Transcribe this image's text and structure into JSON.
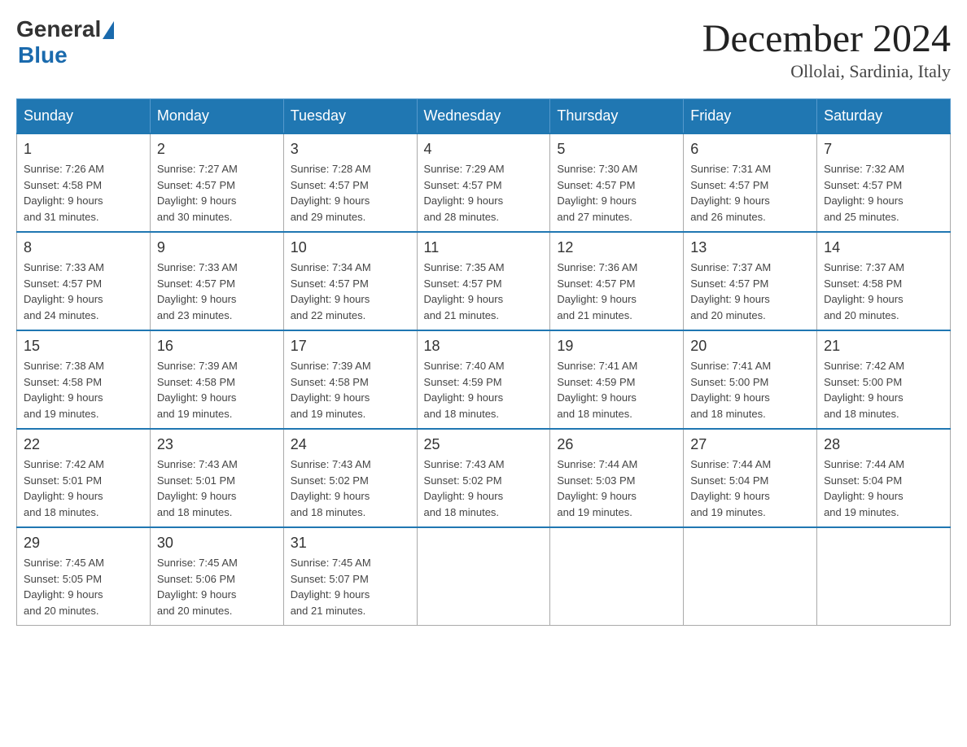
{
  "logo": {
    "general": "General",
    "blue": "Blue"
  },
  "header": {
    "title": "December 2024",
    "location": "Ollolai, Sardinia, Italy"
  },
  "weekdays": [
    "Sunday",
    "Monday",
    "Tuesday",
    "Wednesday",
    "Thursday",
    "Friday",
    "Saturday"
  ],
  "weeks": [
    [
      {
        "day": "1",
        "sunrise": "7:26 AM",
        "sunset": "4:58 PM",
        "daylight": "9 hours and 31 minutes."
      },
      {
        "day": "2",
        "sunrise": "7:27 AM",
        "sunset": "4:57 PM",
        "daylight": "9 hours and 30 minutes."
      },
      {
        "day": "3",
        "sunrise": "7:28 AM",
        "sunset": "4:57 PM",
        "daylight": "9 hours and 29 minutes."
      },
      {
        "day": "4",
        "sunrise": "7:29 AM",
        "sunset": "4:57 PM",
        "daylight": "9 hours and 28 minutes."
      },
      {
        "day": "5",
        "sunrise": "7:30 AM",
        "sunset": "4:57 PM",
        "daylight": "9 hours and 27 minutes."
      },
      {
        "day": "6",
        "sunrise": "7:31 AM",
        "sunset": "4:57 PM",
        "daylight": "9 hours and 26 minutes."
      },
      {
        "day": "7",
        "sunrise": "7:32 AM",
        "sunset": "4:57 PM",
        "daylight": "9 hours and 25 minutes."
      }
    ],
    [
      {
        "day": "8",
        "sunrise": "7:33 AM",
        "sunset": "4:57 PM",
        "daylight": "9 hours and 24 minutes."
      },
      {
        "day": "9",
        "sunrise": "7:33 AM",
        "sunset": "4:57 PM",
        "daylight": "9 hours and 23 minutes."
      },
      {
        "day": "10",
        "sunrise": "7:34 AM",
        "sunset": "4:57 PM",
        "daylight": "9 hours and 22 minutes."
      },
      {
        "day": "11",
        "sunrise": "7:35 AM",
        "sunset": "4:57 PM",
        "daylight": "9 hours and 21 minutes."
      },
      {
        "day": "12",
        "sunrise": "7:36 AM",
        "sunset": "4:57 PM",
        "daylight": "9 hours and 21 minutes."
      },
      {
        "day": "13",
        "sunrise": "7:37 AM",
        "sunset": "4:57 PM",
        "daylight": "9 hours and 20 minutes."
      },
      {
        "day": "14",
        "sunrise": "7:37 AM",
        "sunset": "4:58 PM",
        "daylight": "9 hours and 20 minutes."
      }
    ],
    [
      {
        "day": "15",
        "sunrise": "7:38 AM",
        "sunset": "4:58 PM",
        "daylight": "9 hours and 19 minutes."
      },
      {
        "day": "16",
        "sunrise": "7:39 AM",
        "sunset": "4:58 PM",
        "daylight": "9 hours and 19 minutes."
      },
      {
        "day": "17",
        "sunrise": "7:39 AM",
        "sunset": "4:58 PM",
        "daylight": "9 hours and 19 minutes."
      },
      {
        "day": "18",
        "sunrise": "7:40 AM",
        "sunset": "4:59 PM",
        "daylight": "9 hours and 18 minutes."
      },
      {
        "day": "19",
        "sunrise": "7:41 AM",
        "sunset": "4:59 PM",
        "daylight": "9 hours and 18 minutes."
      },
      {
        "day": "20",
        "sunrise": "7:41 AM",
        "sunset": "5:00 PM",
        "daylight": "9 hours and 18 minutes."
      },
      {
        "day": "21",
        "sunrise": "7:42 AM",
        "sunset": "5:00 PM",
        "daylight": "9 hours and 18 minutes."
      }
    ],
    [
      {
        "day": "22",
        "sunrise": "7:42 AM",
        "sunset": "5:01 PM",
        "daylight": "9 hours and 18 minutes."
      },
      {
        "day": "23",
        "sunrise": "7:43 AM",
        "sunset": "5:01 PM",
        "daylight": "9 hours and 18 minutes."
      },
      {
        "day": "24",
        "sunrise": "7:43 AM",
        "sunset": "5:02 PM",
        "daylight": "9 hours and 18 minutes."
      },
      {
        "day": "25",
        "sunrise": "7:43 AM",
        "sunset": "5:02 PM",
        "daylight": "9 hours and 18 minutes."
      },
      {
        "day": "26",
        "sunrise": "7:44 AM",
        "sunset": "5:03 PM",
        "daylight": "9 hours and 19 minutes."
      },
      {
        "day": "27",
        "sunrise": "7:44 AM",
        "sunset": "5:04 PM",
        "daylight": "9 hours and 19 minutes."
      },
      {
        "day": "28",
        "sunrise": "7:44 AM",
        "sunset": "5:04 PM",
        "daylight": "9 hours and 19 minutes."
      }
    ],
    [
      {
        "day": "29",
        "sunrise": "7:45 AM",
        "sunset": "5:05 PM",
        "daylight": "9 hours and 20 minutes."
      },
      {
        "day": "30",
        "sunrise": "7:45 AM",
        "sunset": "5:06 PM",
        "daylight": "9 hours and 20 minutes."
      },
      {
        "day": "31",
        "sunrise": "7:45 AM",
        "sunset": "5:07 PM",
        "daylight": "9 hours and 21 minutes."
      },
      null,
      null,
      null,
      null
    ]
  ],
  "labels": {
    "sunrise": "Sunrise:",
    "sunset": "Sunset:",
    "daylight": "Daylight:"
  }
}
